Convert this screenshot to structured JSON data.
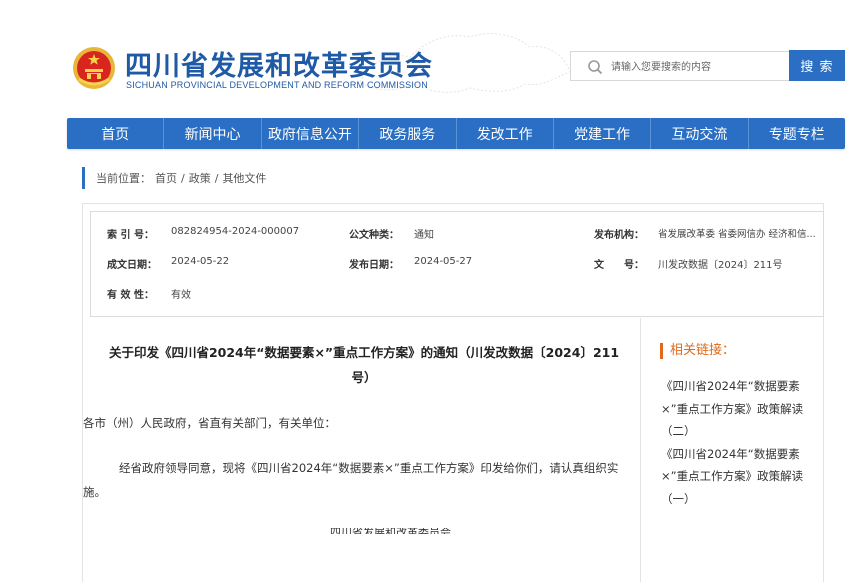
{
  "header": {
    "site_title": "四川省发展和改革委员会",
    "site_subtitle": "SICHUAN PROVINCIAL DEVELOPMENT AND REFORM COMMISSION",
    "search_placeholder": "请输入您要搜索的内容",
    "search_button": "搜 索"
  },
  "nav": {
    "items": [
      "首页",
      "新闻中心",
      "政府信息公开",
      "政务服务",
      "发改工作",
      "党建工作",
      "互动交流",
      "专题专栏"
    ]
  },
  "breadcrumb": {
    "prefix": "当前位置：",
    "path": [
      "首页",
      "/",
      "政策",
      "/",
      "其他文件"
    ]
  },
  "meta": {
    "index_label": "索 引 号：",
    "index_value": "082824954-2024-000007",
    "category_label": "公文种类：",
    "category_value": "通知",
    "issuer_label": "发布机构：",
    "issuer_value": "省发展改革委 省委网信办 经济和信...",
    "created_label": "成文日期：",
    "created_value": "2024-05-22",
    "published_label": "发布日期：",
    "published_value": "2024-05-27",
    "docno_label": "文　　号：",
    "docno_value": "川发改数据〔2024〕211号",
    "validity_label": "有 效 性：",
    "validity_value": "有效"
  },
  "article": {
    "title": "关于印发《四川省2024年“数据要素×”重点工作方案》的通知（川发改数据〔2024〕211号）",
    "salutation": "各市（州）人民政府，省直有关部门，有关单位：",
    "body": "经省政府领导同意，现将《四川省2024年“数据要素×”重点工作方案》印发给你们，请认真组织实施。",
    "cut_line": "四川省发展和改革委员会"
  },
  "related": {
    "title": "相关链接：",
    "items": [
      "《四川省2024年“数据要素×”重点工作方案》政策解读（二）",
      "《四川省2024年“数据要素×”重点工作方案》政策解读（一）"
    ]
  },
  "colors": {
    "brand_blue": "#2a6fc4",
    "title_blue": "#1f5aa6",
    "accent_orange": "#e06a1b"
  }
}
